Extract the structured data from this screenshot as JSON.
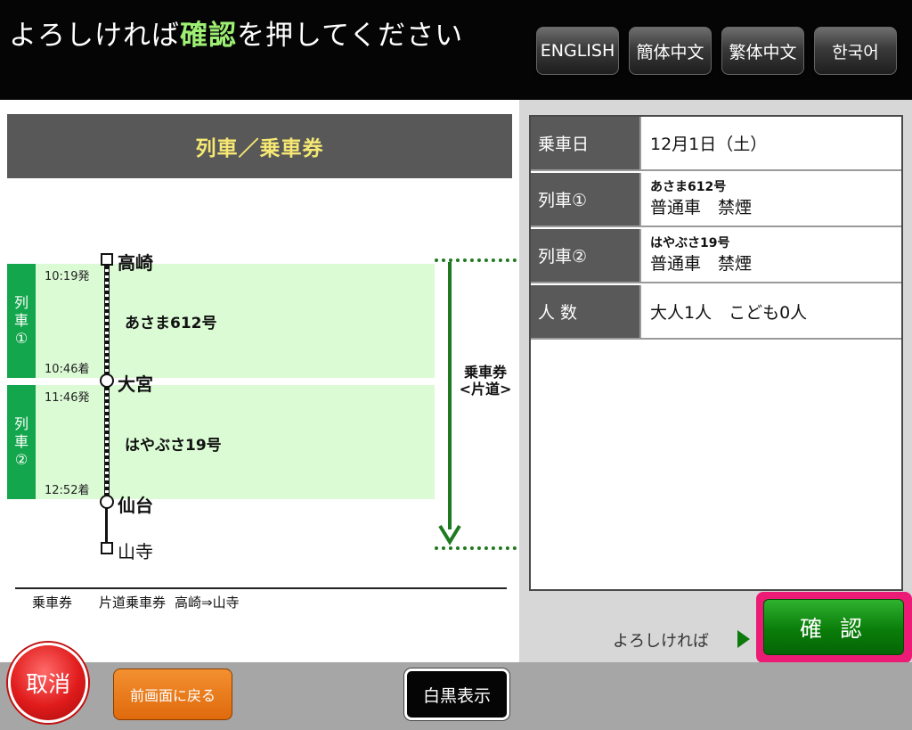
{
  "header": {
    "title_before": "よろしければ",
    "title_highlight": "確認",
    "title_after": "を押してください",
    "languages": [
      "ENGLISH",
      "簡体中文",
      "繁体中文",
      "한국어"
    ]
  },
  "route_panel": {
    "title": "列車／乗車券",
    "segments": [
      {
        "tag": [
          "列",
          "車",
          "①"
        ],
        "depart": "10:19発",
        "arrive": "10:46着",
        "train": "あさま612号"
      },
      {
        "tag": [
          "列",
          "車",
          "②"
        ],
        "depart": "11:46発",
        "arrive": "12:52着",
        "train": "はやぶさ19号"
      }
    ],
    "stations": [
      "高崎",
      "大宮",
      "仙台",
      "山寺"
    ],
    "ticket_label_line1": "乗車券",
    "ticket_label_line2": "<片道>",
    "ticket_summary": {
      "label": "乗車券",
      "type": "片道乗車券",
      "route": "高崎⇒山寺"
    }
  },
  "info": {
    "rows": [
      {
        "head": "乗車日",
        "value": "12月1日（土）"
      },
      {
        "head": "列車①",
        "train": "あさま612号",
        "value": "普通車　禁煙"
      },
      {
        "head": "列車②",
        "train": "はやぶさ19号",
        "value": "普通車　禁煙"
      },
      {
        "head": "人 数",
        "value": "大人1人　こども0人"
      }
    ]
  },
  "actions": {
    "ok_prompt": "よろしければ",
    "confirm": "確 認",
    "cancel": "取消",
    "back": "前画面に戻る",
    "monochrome": "白黒表示"
  }
}
